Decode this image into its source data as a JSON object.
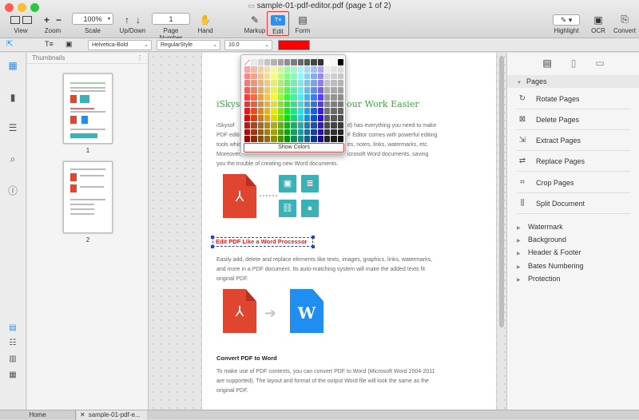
{
  "window": {
    "title": "sample-01-pdf-editor.pdf (page 1 of 2)"
  },
  "toolbar": {
    "view": "View",
    "zoom": "Zoom",
    "scale_value": "100%",
    "scale": "Scale",
    "updown": "Up/Down",
    "page_number_value": "1",
    "page_number": "Page Number",
    "hand": "Hand",
    "markup": "Markup",
    "edit": "Edit",
    "form": "Form",
    "highlight": "Highlight",
    "ocr": "OCR",
    "convert": "Convert"
  },
  "format": {
    "font": "Helvetica-Bold",
    "style": "RegularStyle",
    "size": "10.0",
    "color": "#ff0000"
  },
  "thumbnails": {
    "header": "Thumbnails",
    "pages": [
      "1",
      "2"
    ]
  },
  "popup": {
    "show_colors": "Show Colors"
  },
  "document": {
    "heading": "our Work Easier",
    "para1": [
      "iSkysof",
      "PDF editi",
      "tools whic",
      "Moreover,",
      "you the trouble of creating new Word documents."
    ],
    "para1_right": [
      "d) has everything you need to make",
      "F Editor comes with powerful editing",
      "es, notes, links, watermarks, etc.",
      "icrosoft Word documents, saving"
    ],
    "selected_text": "Edit PDF Like a Word Processor",
    "para2": [
      "Easily add, delete and replace elements like texts, images, graphics, links, watermarks,",
      "and more in a PDF document. Its auto-matching system will make the added texts fit",
      "original PDF."
    ],
    "word_letter": "W",
    "heading2": "Convert PDF to Word",
    "para3": [
      "To make use of PDF contents, you can convert PDF to Word (Microsoft Word 2004-2011",
      "are supported). The layout and format of the output Word file will look the same as the",
      "original PDF."
    ]
  },
  "right_panel": {
    "section": "Pages",
    "items": [
      "Rotate Pages",
      "Delete Pages",
      "Extract Pages",
      "Replace Pages",
      "Crop Pages",
      "Split Document"
    ],
    "collapsed": [
      "Watermark",
      "Background",
      "Header & Footer",
      "Bates Numbering",
      "Protection"
    ]
  },
  "status": {
    "home": "Home",
    "tab": "sample-01-pdf-e..."
  }
}
